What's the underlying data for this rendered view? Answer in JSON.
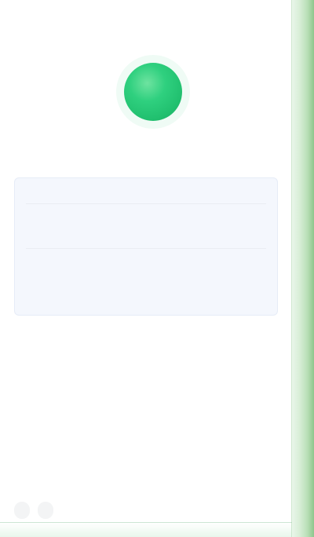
{
  "header": {
    "title": ""
  },
  "status": {
    "headline": "",
    "subline": "",
    "dot_color": "#2fd07f"
  },
  "details_card": {
    "label": "",
    "rows": [
      {
        "text": ""
      },
      {
        "text": ""
      }
    ]
  },
  "sections": [
    {
      "label": "",
      "text": ""
    },
    {
      "label": "",
      "text": ""
    }
  ],
  "link": {
    "text": ""
  },
  "footer": {
    "items": [
      "",
      ""
    ]
  },
  "colors": {
    "accent_green": "#2fd07f",
    "accent_red": "#e36a4a",
    "link_blue": "#2b7cff",
    "card_bg": "#f4f7fd",
    "edge_green": "#8fc58c"
  }
}
